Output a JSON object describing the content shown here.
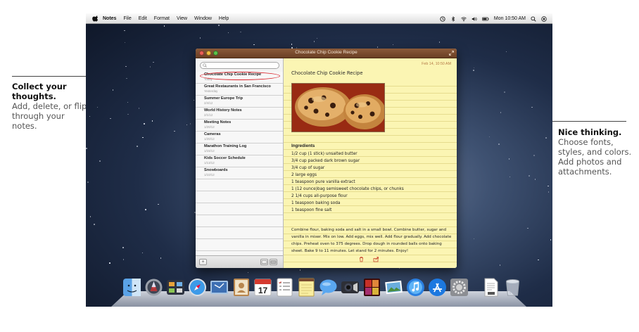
{
  "callouts": {
    "left": {
      "title": "Collect your thoughts.",
      "body": "Add, delete, or flip through your notes."
    },
    "right": {
      "title": "Nice thinking.",
      "body": "Choose fonts, styles, and colors. Add photos and attachments."
    }
  },
  "menubar": {
    "items": [
      "Notes",
      "File",
      "Edit",
      "Format",
      "View",
      "Window",
      "Help"
    ],
    "clock": "Mon 10:50 AM",
    "status_icons": [
      "time-machine-icon",
      "bluetooth-icon",
      "wifi-icon",
      "volume-icon",
      "battery-icon",
      "spotlight-icon",
      "notification-icon"
    ]
  },
  "window": {
    "title": "Chocolate Chip Cookie Recipe",
    "notes": [
      {
        "title": "Chocolate Chip Cookie Recipe",
        "date": "Today"
      },
      {
        "title": "Great Restaurants in San Francisco",
        "date": "Yesterday"
      },
      {
        "title": "Summer Europe Trip",
        "date": "2/4/12"
      },
      {
        "title": "World History Notes",
        "date": "2/1/12"
      },
      {
        "title": "Meeting Notes",
        "date": "1/20/12"
      },
      {
        "title": "Cameras",
        "date": "1/20/12"
      },
      {
        "title": "Marathon Training Log",
        "date": "1/15/12"
      },
      {
        "title": "Kids Soccer Schedule",
        "date": "1/13/12"
      },
      {
        "title": "Snowboards",
        "date": "1/10/12"
      }
    ],
    "footer": {
      "add_label": "+"
    }
  },
  "note": {
    "date": "Feb 14, 10:50 AM",
    "title": "Chocolate Chip Cookie Recipe",
    "ingredients_heading": "Ingredients",
    "ingredients": [
      "1/2 cup (1 stick) unsalted butter",
      "3/4 cup packed dark brown sugar",
      "3/4 cup of sugar",
      "2 large eggs",
      "1 teaspoon pure vanilla extract",
      "1 (12 ounce)bag semisweet chocolate chips, or chunks",
      "2 1/4 cups all-purpose flour",
      "1 teaspoon baking soda",
      "1 teaspoon fine salt"
    ],
    "instructions": "Combine flour, baking soda and salt in a small bowl. Combine butter, sugar and vanilla in mixer. Mix on low. Add eggs, mix well. Add flour gradually. Add chocolate chips. Preheat oven to 375 degrees. Drop dough in rounded balls onto baking sheet. Bake 9 to 11 minutes. Let stand for 2 minutes. Enjoy!"
  },
  "dock": {
    "apps": [
      "Finder",
      "Launchpad",
      "Mission Control",
      "Safari",
      "Mail",
      "Contacts",
      "Calendar",
      "Reminders",
      "Notes",
      "Messages",
      "FaceTime",
      "Photo Booth",
      "iPhoto",
      "iTunes",
      "App Store",
      "System Preferences",
      "Pages",
      "Trash"
    ],
    "calendar_date": "17"
  },
  "colors": {
    "selection_ring": "#d9262d",
    "note_paper": "#fbf5b3",
    "titlebar": "#7a4c30"
  }
}
